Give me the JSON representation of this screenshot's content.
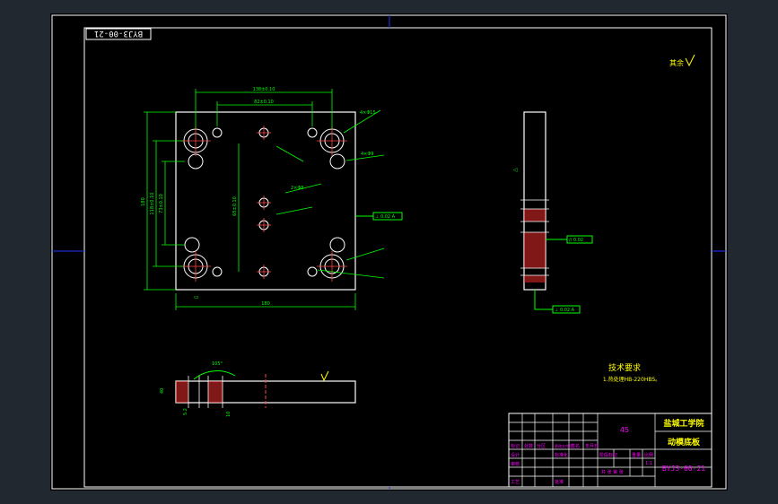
{
  "drawing": {
    "code_stamp": "BYJ3-00-21",
    "dims": {
      "hole_spacing_x1": "138±0.10",
      "hole_spacing_x2": "82±0.10",
      "hole_spacing_y1": "118±0.10",
      "hole_spacing_y2": "73±0.10",
      "hole_spacing_y3": "65±0.10",
      "overall_width": "180",
      "overall_height": "180",
      "small_hole_dia": "4×Φ9",
      "counterbore": "4×Φ15",
      "pin_hole": "2×Φ8",
      "thickness": "40",
      "depth_a": "5.2",
      "depth_b": "10",
      "angle": "105°"
    },
    "gdt": {
      "flatness_1": "// 0.02",
      "perp_1": "⊥ 0.02 A",
      "parallel_side": "// 0.02",
      "perp_side": "⊥ 0.02 A"
    },
    "roughness_top": "其余",
    "tech_req_title": "技术要求",
    "tech_req_item": "1.热处理HB-220HBS。"
  },
  "title_block": {
    "material": "45",
    "school": "盐城工学院",
    "part_name": "动模底板",
    "drawing_no": "BYJ3-00-21",
    "row_labels": [
      "标记",
      "处数",
      "分区",
      "更改文件号",
      "签名",
      "年月日"
    ],
    "design_label": "设计",
    "std_label": "标准化",
    "review_label": "审核",
    "process_label": "工艺",
    "approve_label": "批准",
    "stage_label": "阶段标记",
    "weight_label": "重量",
    "scale_label": "比例",
    "scale_value": "1:1",
    "sheet_label": "共 张 第 张"
  },
  "colors": {
    "frame": "#ffffff",
    "part": "#ffffff",
    "dim": "#00ff00",
    "center": "#ff4444",
    "hatch": "#ff3030",
    "title_text": "#ff00ff",
    "grid_marker": "#2233ff",
    "note": "#ffff00"
  }
}
